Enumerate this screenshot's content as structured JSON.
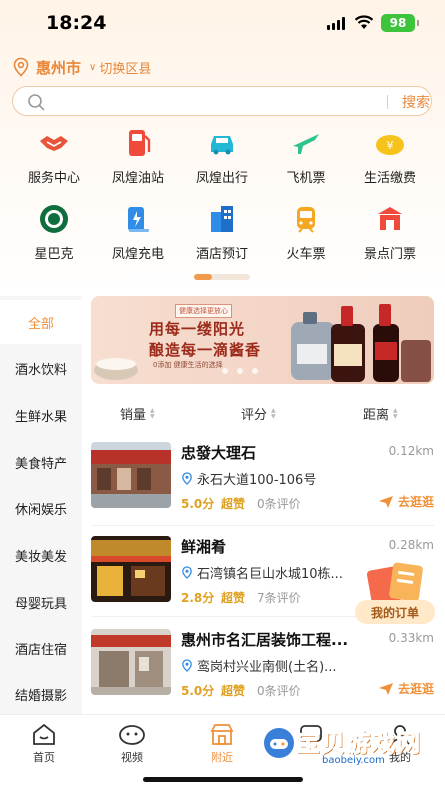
{
  "status_bar": {
    "time": "18:24",
    "battery": "98"
  },
  "location": {
    "city": "惠州市",
    "switch_label": "切换区县"
  },
  "search": {
    "placeholder": "",
    "button_label": "搜索"
  },
  "services": [
    {
      "label": "服务中心",
      "icon": "handshake-icon",
      "color": "#e8563a"
    },
    {
      "label": "凤煌油站",
      "icon": "gas-pump-icon",
      "color": "#ef4a3c"
    },
    {
      "label": "凤煌出行",
      "icon": "taxi-icon",
      "color": "#23b8d8"
    },
    {
      "label": "飞机票",
      "icon": "airplane-icon",
      "color": "#2ec48e"
    },
    {
      "label": "生活缴费",
      "icon": "yen-cloud-icon",
      "color": "#f6c21c"
    },
    {
      "label": "星巴克",
      "icon": "starbucks-icon",
      "color": "#0f6e3e"
    },
    {
      "label": "凤煌充电",
      "icon": "charging-icon",
      "color": "#2f8de8"
    },
    {
      "label": "酒店预订",
      "icon": "hotel-icon",
      "color": "#2f8de8"
    },
    {
      "label": "火车票",
      "icon": "train-icon",
      "color": "#f5a623"
    },
    {
      "label": "景点门票",
      "icon": "ticket-icon",
      "color": "#ef4a3c"
    }
  ],
  "sidebar": {
    "items": [
      {
        "label": "全部",
        "active": true
      },
      {
        "label": "酒水饮料"
      },
      {
        "label": "生鲜水果"
      },
      {
        "label": "美食特产"
      },
      {
        "label": "休闲娱乐"
      },
      {
        "label": "美妆美发"
      },
      {
        "label": "母婴玩具"
      },
      {
        "label": "酒店住宿"
      },
      {
        "label": "结婚摄影"
      }
    ]
  },
  "banner": {
    "tag": "健康选择更放心",
    "line1": "用每一缕阳光",
    "line2": "酿造每一滴酱香",
    "sub": "0添加 健康生活的选择"
  },
  "sort": {
    "sales": "销量",
    "rating": "评分",
    "distance": "距离"
  },
  "stores": [
    {
      "name": "忠發大理石",
      "distance": "0.12km",
      "address": "永石大道100-106号",
      "score": "5.0分",
      "level": "超赞",
      "reviews": "0条评价",
      "action": "去逛逛"
    },
    {
      "name": "鲜湘肴",
      "distance": "0.28km",
      "address": "石湾镇名巨山水城10栋...",
      "score": "2.8分",
      "level": "超赞",
      "reviews": "7条评价",
      "action": ""
    },
    {
      "name": "惠州市名汇居装饰工程...",
      "distance": "0.33km",
      "address": "鸾岗村兴业南侧(土名)...",
      "score": "5.0分",
      "level": "超赞",
      "reviews": "0条评价",
      "action": "去逛逛"
    }
  ],
  "float_order": {
    "label": "我的订单"
  },
  "tabbar": [
    {
      "label": "首页"
    },
    {
      "label": "视频"
    },
    {
      "label": "附近",
      "active": true
    },
    {
      "label": ""
    },
    {
      "label": "我的"
    }
  ],
  "watermark": {
    "text": "宝贝游戏网",
    "url": "baobeiy.com"
  },
  "colors": {
    "accent": "#f0913a",
    "score": "#e0a020"
  }
}
